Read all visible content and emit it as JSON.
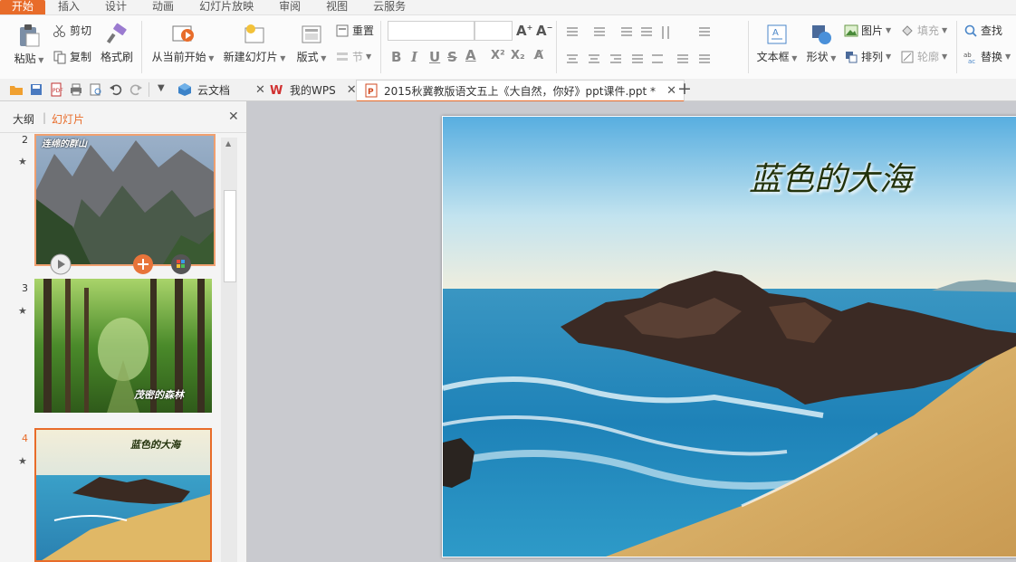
{
  "ribbon_tabs": [
    "开始",
    "插入",
    "设计",
    "动画",
    "幻灯片放映",
    "审阅",
    "视图",
    "云服务"
  ],
  "ribbon": {
    "paste": "粘贴",
    "cut": "剪切",
    "copy": "复制",
    "format_painter": "格式刷",
    "from_current": "从当前开始",
    "new_slide": "新建幻灯片",
    "layout": "版式",
    "reset": "重置",
    "section": "节",
    "textbox": "文本框",
    "shape": "形状",
    "picture": "图片",
    "fill": "填充",
    "arrange": "排列",
    "outline": "轮廓",
    "find": "查找",
    "replace": "替换"
  },
  "doc_tabs": [
    {
      "label": "云文档"
    },
    {
      "label": "我的WPS"
    },
    {
      "label": "2015秋冀教版语文五上《大自然，你好》ppt课件.ppt *"
    }
  ],
  "panel": {
    "outline_tab": "大纲",
    "divider": "|",
    "slides_tab": "幻灯片"
  },
  "slides": [
    {
      "number": "2",
      "title": "连绵的群山"
    },
    {
      "number": "3",
      "title": "茂密的森林"
    },
    {
      "number": "4",
      "title": "蓝色的大海"
    }
  ],
  "current_slide": {
    "title": "蓝色的大海"
  },
  "colors": {
    "accent": "#e86c2a"
  }
}
